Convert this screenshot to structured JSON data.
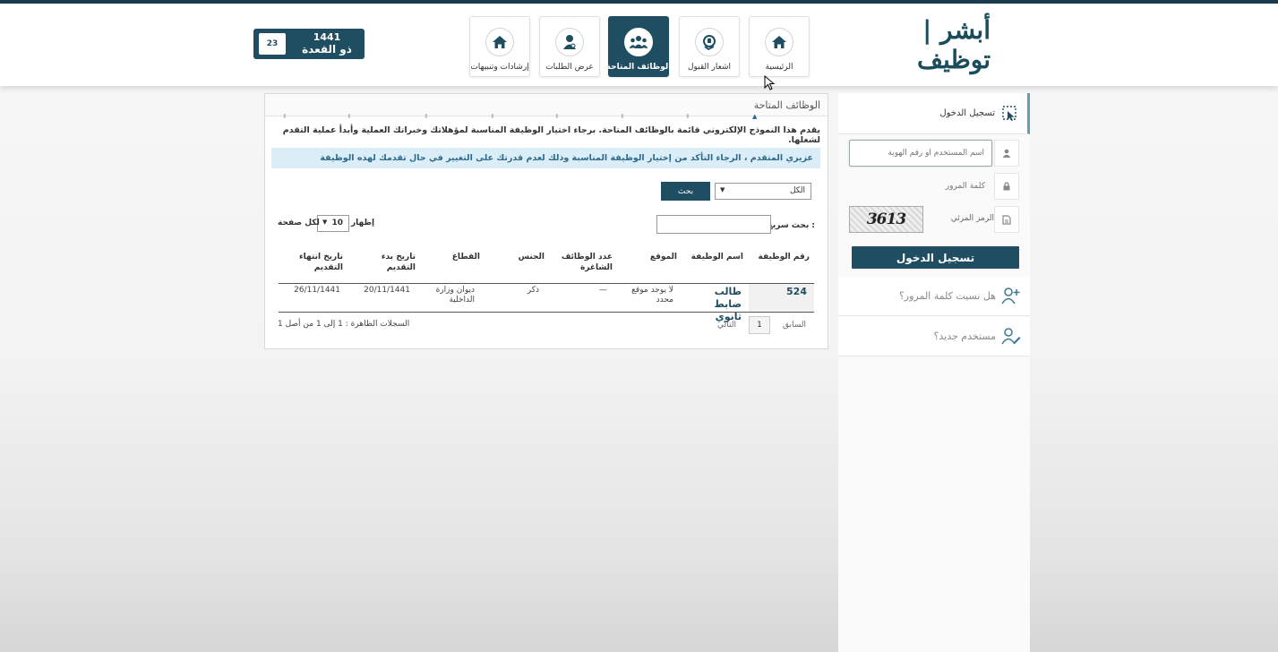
{
  "header": {
    "logo_text": "أبشر | توظيف",
    "nav": [
      {
        "label": "الرئيسية",
        "icon": "home-icon"
      },
      {
        "label": "اشعار القبول",
        "icon": "hand-card-icon"
      },
      {
        "label": "الوظائف المتاحة",
        "icon": "people-group-icon",
        "active": true
      },
      {
        "label": "عرض الطلبات",
        "icon": "user-request-icon"
      },
      {
        "label": "إرشادات وتنبيهات",
        "icon": "home-icon"
      }
    ],
    "date": {
      "day": "23",
      "year": "1441",
      "month": "ذو القعدة"
    }
  },
  "sidebar": {
    "login_title": "تسجيل الدخول",
    "username_placeholder": "اسم المستخدم أو رقم الهوية",
    "password_placeholder": "كلمة المرور",
    "captcha_label": "الرمز المرئي",
    "captcha_code": "3613",
    "login_button": "تسجيل الدخول",
    "forgot_password": "هل نسيت كلمة المرور؟",
    "new_user": "مستخدم جديد؟"
  },
  "panel": {
    "title": "الوظائف المتاحة",
    "intro": "يقدم هذا النموذج الإلكتروني قائمة بالوظائف المتاحة. برجاء اختيار الوظيفة المناسبة لمؤهلاتك وخبراتك العملية وأبدأ عملية التقدم لشغلها.",
    "notice": "عزيزي المتقدم ، الرجاء التأكد من إختيار الوظيفة المناسبة وذلك لعدم قدرتك على التغيير في حال تقدمك لهذه الوظيفة",
    "filter_value": "الكل",
    "search_button": "بحث",
    "quick_search_label": "بحث سريع :",
    "show_label": "إظهار",
    "page_size": "10",
    "per_page_label": "لكل صفحة",
    "columns": [
      "رقم الوظيفة",
      "اسم الوظيفة",
      "الموقع",
      "عدد الوظائف الشاغرة",
      "الجنس",
      "القطاع",
      "تاريخ بدء التقديم",
      "تاريخ انتهاء التقديم"
    ],
    "rows": [
      {
        "id": "524",
        "name": "طالب ضابط ثانوي",
        "location": "لا يوجد موقع محدد",
        "vacancies": "—",
        "gender": "ذكر",
        "sector": "ديوان وزارة الداخلية",
        "start": "20/11/1441",
        "end": "26/11/1441"
      }
    ],
    "pager": {
      "prev": "السابق",
      "current": "1",
      "next": "التالي"
    },
    "records_text": "السجلات الظاهرة : 1 إلى 1 من أصل 1"
  }
}
